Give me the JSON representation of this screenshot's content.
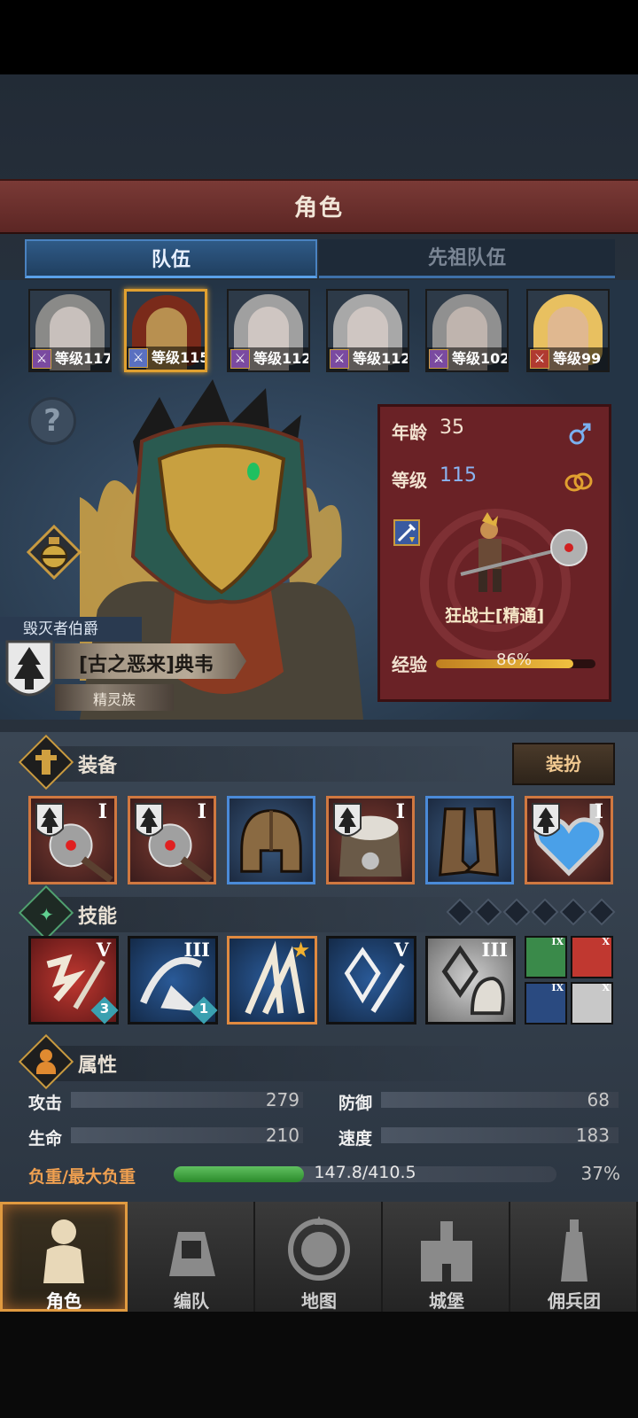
{
  "title": "角色",
  "tabs": {
    "team": "队伍",
    "ancestor_team": "先祖队伍"
  },
  "team_members": [
    {
      "level_text": "等级117",
      "class_color": "#7a4aa0",
      "skin": "#c8c0bc",
      "hair": "#8a8a88"
    },
    {
      "level_text": "等级115",
      "class_color": "#5a70c0",
      "skin": "#b89050",
      "hair": "#7a2a1a"
    },
    {
      "level_text": "等级112",
      "class_color": "#7a4aa0",
      "skin": "#cfc6c2",
      "hair": "#a0a0a0"
    },
    {
      "level_text": "等级112",
      "class_color": "#7a4aa0",
      "skin": "#cfc6c2",
      "hair": "#a8a8a8"
    },
    {
      "level_text": "等级102",
      "class_color": "#7a4aa0",
      "skin": "#bfb4ae",
      "hair": "#909090"
    },
    {
      "level_text": "等级99",
      "class_color": "#b03a30",
      "skin": "#e0b890",
      "hair": "#e8c060"
    }
  ],
  "hero": {
    "noble_title": "毁灭者伯爵",
    "name": "[古之恶来]典韦",
    "race": "精灵族",
    "age_label": "年龄",
    "age_value": "35",
    "level_label": "等级",
    "level_value": "115",
    "class_name": "狂战士[精通]",
    "exp_label": "经验",
    "exp_text": "86%",
    "exp_fraction": 0.86,
    "gender_icon": "male-icon",
    "ring_icon": "ring-icon"
  },
  "equipment": {
    "title": "装备",
    "dress_button": "装扮",
    "slots": [
      {
        "icon": "flail-weapon-icon",
        "tier": "I",
        "rarity": "orange"
      },
      {
        "icon": "flail-weapon-icon",
        "tier": "I",
        "rarity": "orange"
      },
      {
        "icon": "helmet-icon",
        "tier": "",
        "rarity": "blue"
      },
      {
        "icon": "fur-armor-icon",
        "tier": "I",
        "rarity": "orange"
      },
      {
        "icon": "leather-boots-icon",
        "tier": "",
        "rarity": "blue"
      },
      {
        "icon": "heart-amulet-icon",
        "tier": "I",
        "rarity": "orange"
      }
    ]
  },
  "skills": {
    "title": "技能",
    "slot_count": 6,
    "items": [
      {
        "icon": "shatter-strike-icon",
        "tier": "V",
        "style": "red",
        "badge": "3"
      },
      {
        "icon": "leap-slash-icon",
        "tier": "III",
        "style": "blue",
        "badge": "1"
      },
      {
        "icon": "claw-rend-icon",
        "tier": "★",
        "style": "orange",
        "badge": ""
      },
      {
        "icon": "crystal-strike-icon",
        "tier": "V",
        "style": "blue",
        "badge": ""
      },
      {
        "icon": "crystal-guard-icon",
        "tier": "III",
        "style": "gray",
        "badge": ""
      }
    ],
    "passives": [
      {
        "icon": "beast-roar-icon",
        "tier": "IX",
        "color": "#3a8a4a"
      },
      {
        "icon": "sword-bleed-icon",
        "tier": "X",
        "color": "#c03830"
      },
      {
        "icon": "impact-blast-icon",
        "tier": "IX",
        "color": "#2a4a80"
      },
      {
        "icon": "holy-shield-icon",
        "tier": "X",
        "color": "#c8c8c8"
      }
    ]
  },
  "attributes": {
    "title": "属性",
    "attack_label": "攻击",
    "attack_value": "279",
    "defense_label": "防御",
    "defense_value": "68",
    "hp_label": "生命",
    "hp_value": "210",
    "speed_label": "速度",
    "speed_value": "183",
    "load_label": "负重/最大负重",
    "load_text": "147.8/410.5",
    "load_percent": "37%",
    "load_fraction": 0.37
  },
  "nav": [
    {
      "label": "角色",
      "icon": "knight-icon",
      "active": true
    },
    {
      "label": "编队",
      "icon": "formation-icon",
      "active": false
    },
    {
      "label": "地图",
      "icon": "compass-map-icon",
      "active": false
    },
    {
      "label": "城堡",
      "icon": "castle-icon",
      "active": false
    },
    {
      "label": "佣兵团",
      "icon": "mercenary-icon",
      "active": false
    }
  ],
  "colors": {
    "accent_gold": "#e0a030",
    "title_red": "#7a3a36",
    "active_tab_blue": "#2f5a86",
    "exp_fill": "#f0c040",
    "load_fill": "#3aaa3a"
  }
}
